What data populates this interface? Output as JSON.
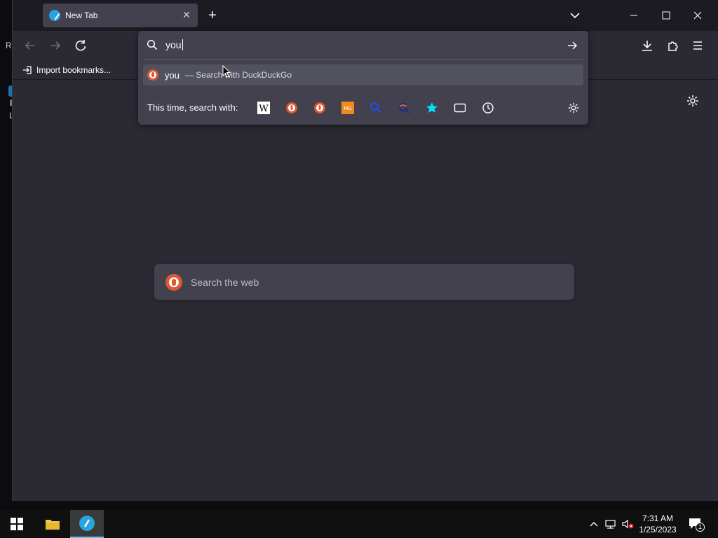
{
  "browser": {
    "tab_title": "New Tab",
    "bookmark_import_label": "Import bookmarks...",
    "newtab_search_placeholder": "Search the web"
  },
  "urlbar": {
    "typed_text": "you",
    "result_query": "you",
    "result_action": "— Search with DuckDuckGo",
    "oneoff_label": "This time, search with:",
    "engines": [
      "wikipedia-icon",
      "duckduckgo-icon",
      "duckduckgo-icon",
      "metager-icon",
      "search-engine-icon",
      "search-engine-icon",
      "bookmarks-star-icon",
      "tabs-icon",
      "history-icon"
    ]
  },
  "desktop": {
    "edge_letters": [
      "R",
      "I",
      "L"
    ]
  },
  "taskbar": {
    "time": "7:31 AM",
    "date": "1/25/2023",
    "notification_count": "1"
  },
  "colors": {
    "chrome_bg": "#1c1b22",
    "content_bg": "#2b2a33",
    "field_bg": "#42414d",
    "accent": "#27a3e0",
    "ddg_orange": "#de5833"
  }
}
